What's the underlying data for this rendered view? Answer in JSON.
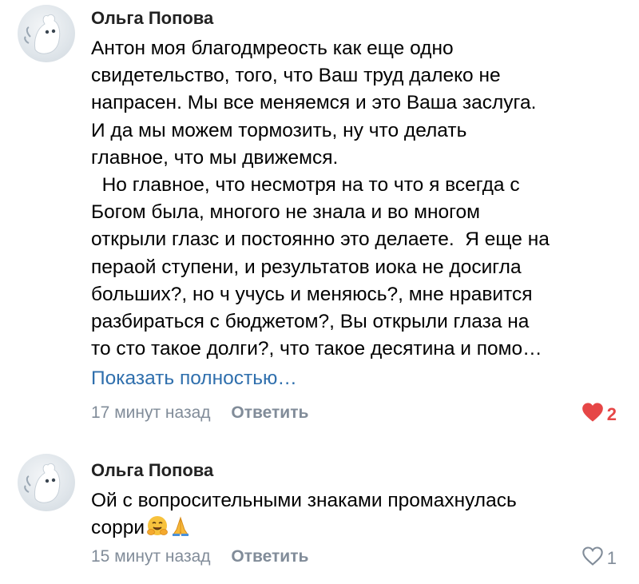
{
  "comments": [
    {
      "author": "Ольга Попова",
      "text_lines": [
        "Антон моя благодмреость как еще одно",
        "свидетельство, того, что Ваш труд далеко не",
        "напрасен. Мы все меняемся и это Ваша заслуга.",
        "И да мы можем тормозить, ну что делать",
        "главное, что мы движемся.",
        "  Но главное, что несмотря на то что я всегда с",
        "Богом была, многого не знала и во многом",
        "открыли глазс и постоянно это делаете.  Я еще на",
        "пераой ступени, и результатов иока не досигла",
        "больших?, но ч учусь и меняюсь?, мне нравится",
        "разбираться с бюджетом?, Вы открыли глаза на",
        "то сто такое долги?, что такое десятина и помо…"
      ],
      "show_more": "Показать полностью…",
      "time": "17 минут назад",
      "reply": "Ответить",
      "likes": "2",
      "liked": true
    },
    {
      "author": "Ольга Попова",
      "text_lines": [
        "Ой с вопросительными знаками промахнулась",
        "сорри"
      ],
      "emojis": [
        "hugging-face-icon",
        "folded-hands-icon"
      ],
      "time": "15 минут назад",
      "reply": "Ответить",
      "likes": "1",
      "liked": false
    }
  ],
  "colors": {
    "link": "#2f6fad",
    "meta": "#818c99",
    "heart_active": "#e64646"
  }
}
